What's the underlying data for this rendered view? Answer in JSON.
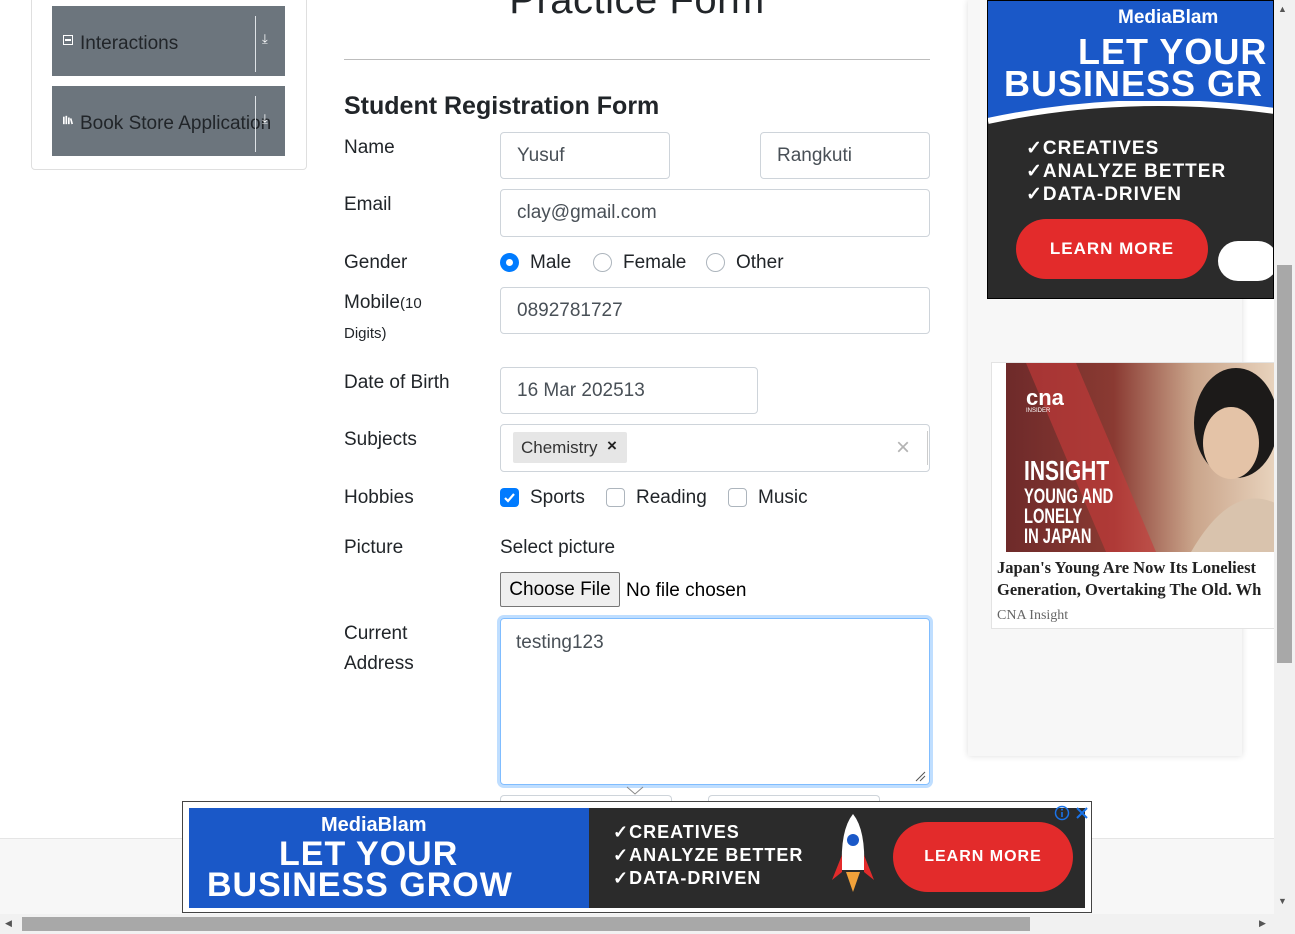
{
  "sidebar": {
    "groups": [
      {
        "label": "Interactions"
      },
      {
        "label": "Book Store Application"
      }
    ]
  },
  "form": {
    "page_title": "Practice Form",
    "heading": "Student Registration Form",
    "name_label": "Name",
    "first_name": "Yusuf",
    "last_name": "Rangkuti",
    "email_label": "Email",
    "email": "clay@gmail.com",
    "gender_label": "Gender",
    "gender_options": [
      "Male",
      "Female",
      "Other"
    ],
    "gender_selected": "Male",
    "mobile_label": "Mobile",
    "mobile_hint_1": "(10",
    "mobile_hint_2": "Digits)",
    "mobile": "0892781727",
    "dob_label": "Date of Birth",
    "dob": "16 Mar 202513",
    "subjects_label": "Subjects",
    "subjects": [
      "Chemistry"
    ],
    "subject_remove": "×",
    "subjects_clear": "×",
    "hobbies_label": "Hobbies",
    "hobbies": [
      "Sports",
      "Reading",
      "Music"
    ],
    "hobbies_checked": [
      "Sports"
    ],
    "picture_label": "Picture",
    "picture_hint": "Select picture",
    "choose_file": "Choose File",
    "no_file": "No file chosen",
    "address_label_1": "Current",
    "address_label_2": "Address",
    "address": "testing123"
  },
  "ads": {
    "top": {
      "brand": "MediaBlam",
      "line1": "LET YOUR",
      "line2": "BUSINESS GR",
      "bullets": [
        "✓CREATIVES",
        "✓ANALYZE BETTER",
        "✓DATA-DRIVEN"
      ],
      "cta": "LEARN MORE"
    },
    "article": {
      "logo": "cna",
      "logo_sub": "INSIDER",
      "overlay_1": "INSIGHT",
      "overlay_2": "YOUNG AND",
      "overlay_3": "LONELY",
      "overlay_4": "IN JAPAN",
      "headline_1": "Japan's Young Are Now Its Loneliest",
      "headline_2": "Generation, Overtaking The Old. Wh",
      "source": "CNA Insight"
    },
    "bottom": {
      "brand": "MediaBlam",
      "line1": "LET YOUR",
      "line2": "BUSINESS GROW",
      "bullets": [
        "✓CREATIVES",
        "✓ANALYZE BETTER",
        "✓DATA-DRIVEN"
      ],
      "cta": "LEARN MORE"
    }
  },
  "colors": {
    "primary": "#007bff",
    "sidebar_group": "#6c757d",
    "ad_blue": "#1a58c8",
    "ad_red": "#e32b2b"
  }
}
